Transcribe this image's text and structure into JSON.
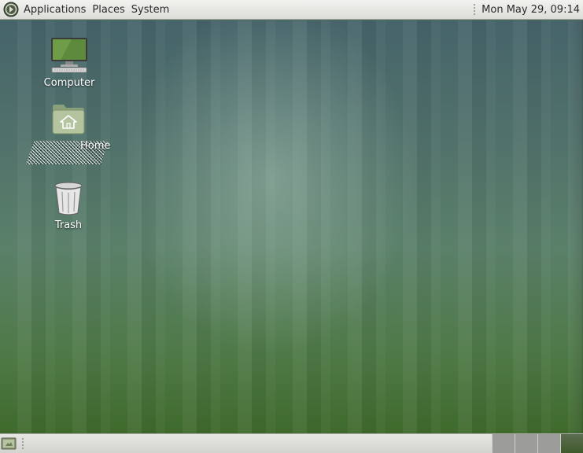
{
  "top_panel": {
    "menus": [
      "Applications",
      "Places",
      "System"
    ],
    "clock": "Mon May 29, 09:14"
  },
  "desktop": {
    "icons": [
      {
        "label": "Computer",
        "icon": "computer-icon"
      },
      {
        "label": "Home",
        "icon": "home-folder-icon",
        "selected": true
      },
      {
        "label": "Trash",
        "icon": "trash-icon"
      }
    ]
  },
  "bottom_panel": {
    "show_desktop_icon": "show-desktop-icon",
    "workspaces": 4,
    "active_workspace": 4
  },
  "colors": {
    "panel": "#e0e0dc",
    "desktop_top": "#46646a",
    "desktop_bottom": "#3f6a2c"
  }
}
